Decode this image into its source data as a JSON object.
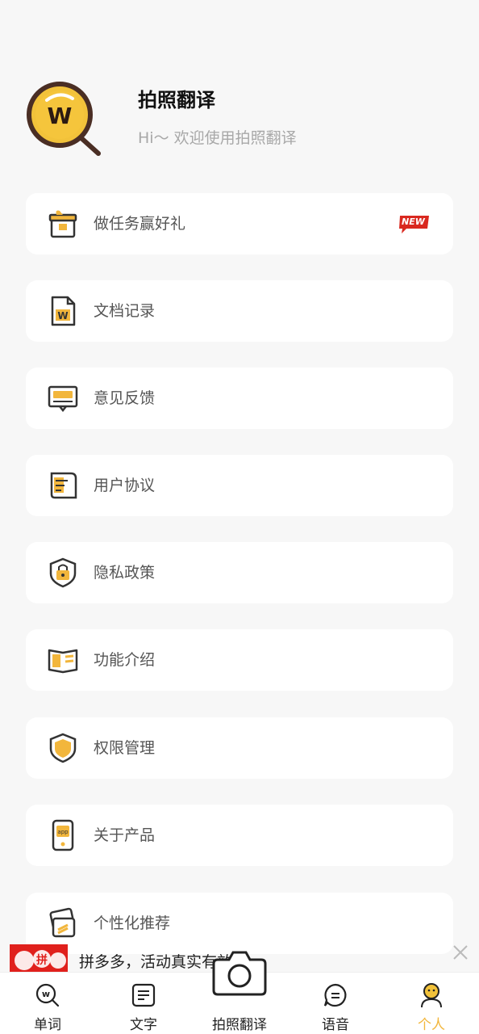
{
  "header": {
    "app_name": "拍照翻译",
    "subtitle": "Hi～ 欢迎使用拍照翻译",
    "logo_letter": "W"
  },
  "menu": [
    {
      "label": "做任务赢好礼",
      "icon": "gift-icon",
      "badge": "NEW"
    },
    {
      "label": "文档记录",
      "icon": "document-icon"
    },
    {
      "label": "意见反馈",
      "icon": "feedback-icon"
    },
    {
      "label": "用户协议",
      "icon": "agreement-icon"
    },
    {
      "label": "隐私政策",
      "icon": "privacy-shield-icon"
    },
    {
      "label": "功能介绍",
      "icon": "book-icon"
    },
    {
      "label": "权限管理",
      "icon": "permission-shield-icon"
    },
    {
      "label": "关于产品",
      "icon": "app-phone-icon"
    },
    {
      "label": "个性化推荐",
      "icon": "cards-icon"
    }
  ],
  "ad": {
    "text": "拼多多，活动真实有效!",
    "image_text": "拼"
  },
  "tabbar": {
    "tabs": [
      {
        "label": "单词",
        "icon": "word-search-icon"
      },
      {
        "label": "文字",
        "icon": "text-doc-icon"
      },
      {
        "label": "拍照翻译",
        "icon": "camera-icon"
      },
      {
        "label": "语音",
        "icon": "voice-bubble-icon"
      },
      {
        "label": "个人",
        "icon": "person-icon"
      }
    ],
    "active_index": 4
  },
  "colors": {
    "accent": "#f2b63c",
    "background": "#f7f7f7",
    "badge_red": "#d9281f"
  }
}
